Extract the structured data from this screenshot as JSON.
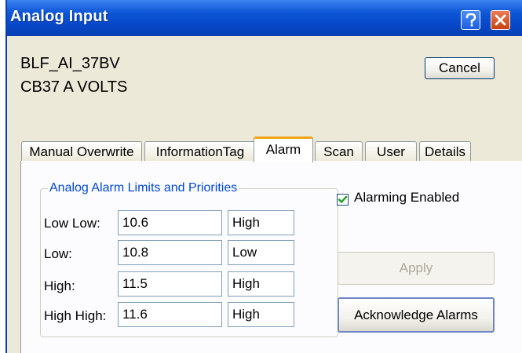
{
  "window": {
    "title": "Analog Input"
  },
  "titlebar_buttons": {
    "help_icon": "question-mark",
    "close_icon": "x-mark"
  },
  "header": {
    "record_name": "BLF_AI_37BV",
    "record_description": "CB37 A VOLTS"
  },
  "buttons": {
    "cancel": "Cancel",
    "apply": "Apply",
    "acknowledge": "Acknowledge Alarms"
  },
  "tabs": [
    {
      "label": "Manual Overwrite",
      "active": false
    },
    {
      "label": "InformationTag",
      "active": false
    },
    {
      "label": "Alarm",
      "active": true
    },
    {
      "label": "Scan",
      "active": false
    },
    {
      "label": "User",
      "active": false
    },
    {
      "label": "Details",
      "active": false
    }
  ],
  "alarm": {
    "group_title": "Analog Alarm Limits and Priorities",
    "alarming_enabled_label": "Alarming Enabled",
    "alarming_enabled": true,
    "limits": [
      {
        "label": "Low Low:",
        "value": "10.6",
        "priority": "High"
      },
      {
        "label": "Low:",
        "value": "10.8",
        "priority": "Low"
      },
      {
        "label": "High:",
        "value": "11.5",
        "priority": "High"
      },
      {
        "label": "High High:",
        "value": "11.6",
        "priority": "High"
      }
    ]
  },
  "colors": {
    "titlebar": "#0a3fb0",
    "close_button": "#c8420f",
    "active_tab_accent": "#f2a317",
    "group_title": "#0046d5",
    "checkbox_check": "#21a121"
  }
}
